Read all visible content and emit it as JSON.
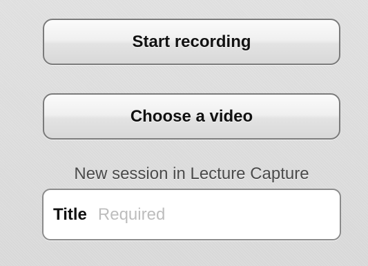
{
  "actions": {
    "start_recording_label": "Start recording",
    "choose_video_label": "Choose a video"
  },
  "session": {
    "heading": "New session in Lecture Capture",
    "title_label": "Title",
    "title_value": "",
    "title_placeholder": "Required"
  },
  "colors": {
    "background": "#e1e1e1",
    "button_border": "#7a7a7a",
    "field_background": "#ffffff",
    "placeholder": "#bdbdbd"
  }
}
